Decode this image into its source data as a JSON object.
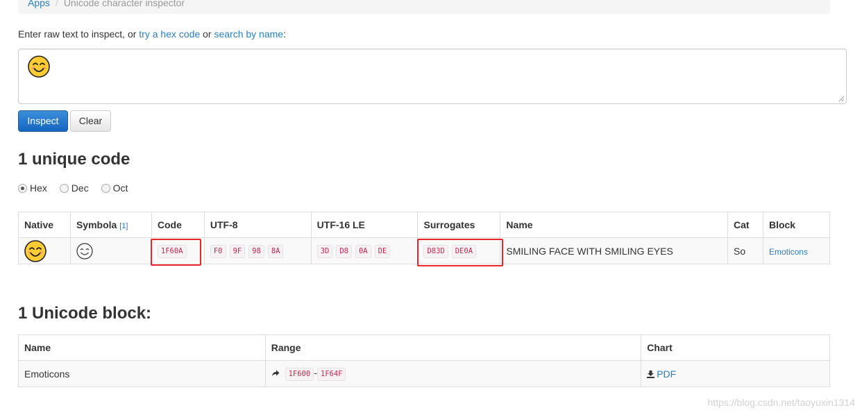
{
  "breadcrumb": {
    "items": [
      "Apps",
      "Unicode character inspector"
    ]
  },
  "intro": {
    "prefix": "Enter raw text to inspect, or ",
    "hex_link": "try a hex code",
    "middle": " or ",
    "name_link": "search by name",
    "suffix": ":"
  },
  "input": {
    "value": "😊"
  },
  "buttons": {
    "inspect": "Inspect",
    "clear": "Clear"
  },
  "codes_heading": "1 unique code",
  "radix": {
    "options": [
      "Hex",
      "Dec",
      "Oct"
    ],
    "selected": "Hex"
  },
  "codes_table": {
    "headers": {
      "native": "Native",
      "symbola": "Symbola",
      "symbola_ref": "[1]",
      "code": "Code",
      "utf8": "UTF-8",
      "utf16": "UTF-16 LE",
      "surrogates": "Surrogates",
      "name": "Name",
      "cat": "Cat",
      "block": "Block"
    },
    "rows": [
      {
        "code": "1F60A",
        "utf8": [
          "F0",
          "9F",
          "98",
          "8A"
        ],
        "utf16": [
          "3D",
          "D8",
          "0A",
          "DE"
        ],
        "surrogates": [
          "D83D",
          "DE0A"
        ],
        "name": "SMILING FACE WITH SMILING EYES",
        "cat": "So",
        "block": "Emoticons"
      }
    ]
  },
  "blocks_heading": "1 Unicode block:",
  "blocks_table": {
    "headers": {
      "name": "Name",
      "range": "Range",
      "chart": "Chart"
    },
    "rows": [
      {
        "name": "Emoticons",
        "range_start": "1F600",
        "range_sep": "-",
        "range_end": "1F64F",
        "chart_link": "PDF"
      }
    ]
  },
  "watermark": "https://blog.csdn.net/taoyuxin1314",
  "colors": {
    "link": "#2a7fc0",
    "primary": "#1565c0",
    "highlight": "#e8262b",
    "code_text": "#c7254e"
  }
}
